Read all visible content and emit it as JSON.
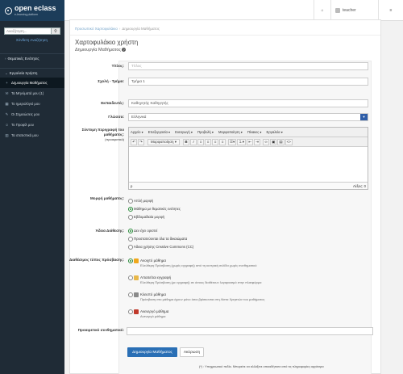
{
  "brand": {
    "name": "open eclass",
    "tagline": "e-learning platform"
  },
  "sidebar": {
    "search_placeholder": "Αναζήτηση...",
    "advanced_search": "Σύνθετη Αναζήτηση",
    "section_courses": "Θεματικές Ενότητες",
    "section_tools": "Εργαλεία Χρήστη",
    "items": [
      {
        "label": "Δημιουργία Μαθήματος"
      },
      {
        "label": "Τα Μηνύματά μου (1)"
      },
      {
        "label": "Το ημερολόγιό μου"
      },
      {
        "label": "Οι Σημειώσεις μου"
      },
      {
        "label": "Το Προφίλ μου"
      },
      {
        "label": "Τα στατιστικά μου"
      }
    ]
  },
  "topbar": {
    "user": "teacher"
  },
  "breadcrumb": {
    "home": "Προσωπικό Χαρτοφυλάκιο",
    "current": "Δημιουργία Μαθήματος"
  },
  "page": {
    "title": "Χαρτοφυλάκιο χρήστη",
    "subtitle": "Δημιουργία Μαθήματος"
  },
  "form": {
    "title_label": "Τίτλος:",
    "title_placeholder": "Τίτλος",
    "school_label": "Σχολή - Τμήμα:",
    "school_value": "Τμήμα 1",
    "teachers_label": "Εκπαιδευτές:",
    "teachers_value": "Καθηγητής Καθηγητής",
    "lang_label": "Γλώσσα:",
    "lang_value": "Ελληνικά",
    "desc_label": "Σύντομη περιγραφή του μαθήματος:",
    "desc_optional": "(προαιρετικό)",
    "editor": {
      "menus": [
        "Αρχείο",
        "Επεξεργασία",
        "Εισαγωγή",
        "Προβολή",
        "Μορφοποίηση",
        "Πίνακες",
        "Εργαλεία"
      ],
      "format_label": "Μορφοποίηση",
      "words": "Λέξεις: 0",
      "path": "p"
    },
    "format_label": "Μορφή μαθήματος:",
    "format_options": [
      {
        "label": "Απλή μορφή",
        "selected": false
      },
      {
        "label": "Μάθημα με θεματικές ενότητες",
        "selected": true
      },
      {
        "label": "Εβδομαδιαία μορφή",
        "selected": false
      }
    ],
    "license_label": "Άδεια Διάθεσης:",
    "license_options": [
      {
        "label": "Δεν έχει οριστεί",
        "selected": true
      },
      {
        "label": "Προστατεύονται όλα τα δικαιώματα",
        "selected": false
      },
      {
        "label": "Άδεια χρήσης Creative Commons (CC)",
        "selected": false
      }
    ],
    "access_label": "Διαθέσιμος τύπος πρόσβασης:",
    "access_options": [
      {
        "title": "Ανοιχτό μάθημα",
        "desc": "Ελεύθερη Πρόσβαση (χωρίς εγγραφή) από τη κεντρική σελίδα χωρίς συνθηματικό",
        "selected": true,
        "color": "#f0a81c"
      },
      {
        "title": "Απαιτείται εγγραφή",
        "desc": "Ελεύθερη Πρόσβαση (με εγγραφή) σε όσους διαθέτουν λογαριασμό στην πλατφόρμα",
        "selected": false,
        "color": "#e8b84a"
      },
      {
        "title": "Κλειστό μάθημα",
        "desc": "Πρόσβαση στο μάθημα έχουν μόνο όσοι βρίσκονται στη Λίστα Χρηστών του μαθήματος",
        "selected": false,
        "color": "#8a8a8a"
      },
      {
        "title": "Ανενεργό μάθημα",
        "desc": "Ανενεργό μάθημα",
        "selected": false,
        "color": "#c0392b"
      }
    ],
    "password_label": "Προαιρετικό συνθηματικό:",
    "submit": "Δημιουργία Μαθήματος",
    "cancel": "Ακύρωση",
    "footnote": "(*) : Υποχρεωτικό πεδίο. Μπορείτε να αλλάξετε οποιαδήποτε από τις πληροφορίες αργότερα"
  }
}
